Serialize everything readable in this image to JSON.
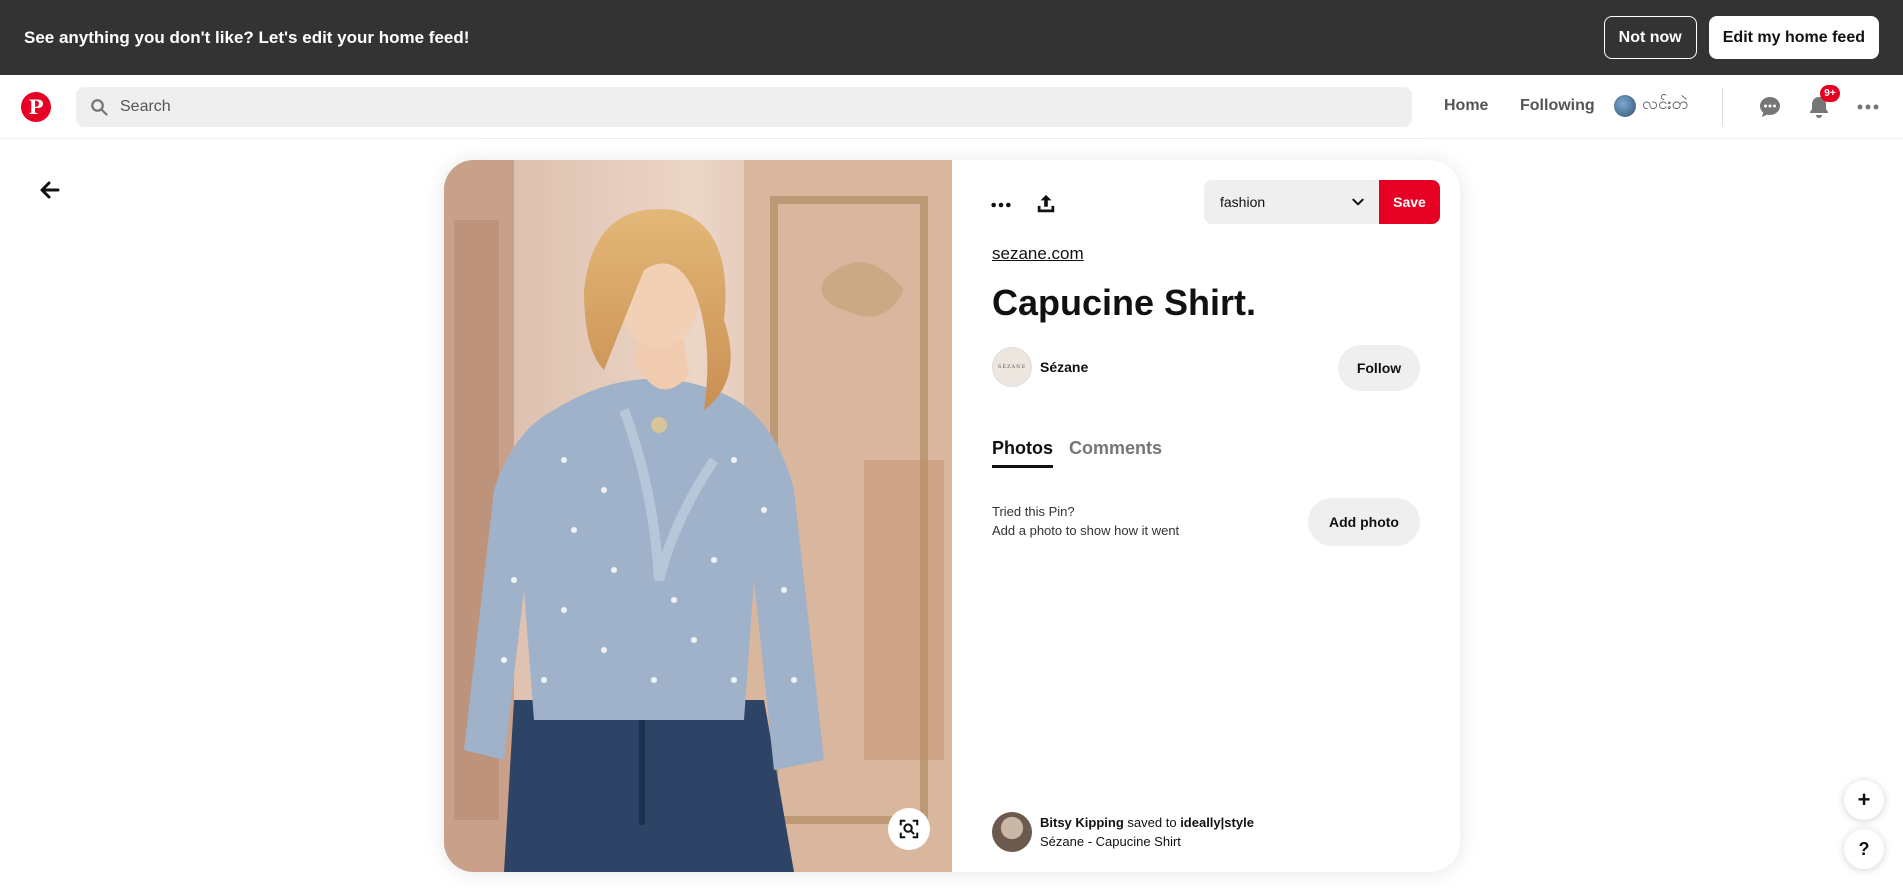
{
  "banner": {
    "message": "See anything you don't like? Let's edit your home feed!",
    "not_now_label": "Not now",
    "edit_feed_label": "Edit my home feed"
  },
  "nav": {
    "logo_icon": "pinterest-logo",
    "search_placeholder": "Search",
    "home_label": "Home",
    "following_label": "Following",
    "profile_name": "လင်းတဲ",
    "notification_badge": "9+",
    "icons": [
      "search-icon",
      "messages-icon",
      "bell-icon",
      "more-icon"
    ]
  },
  "pin": {
    "board_name": "fashion",
    "save_label": "Save",
    "source_link": "sezane.com",
    "title": "Capucine Shirt.",
    "creator": {
      "name": "Sézane",
      "logo_text": "SÉZANE",
      "follow_label": "Follow"
    },
    "tabs": [
      "Photos",
      "Comments"
    ],
    "active_tab": "Photos",
    "tried": {
      "line1": "Tried this Pin?",
      "line2": "Add a photo to show how it went",
      "button_label": "Add photo"
    },
    "saved_by": {
      "user": "Bitsy Kipping",
      "action": "saved to",
      "board": "ideally|style",
      "caption": "Sézane - Capucine Shirt"
    }
  },
  "floating": {
    "plus_label": "+",
    "help_label": "?"
  },
  "colors": {
    "brand": "#e60023",
    "banner_bg": "#333333",
    "input_bg": "#efefef"
  }
}
